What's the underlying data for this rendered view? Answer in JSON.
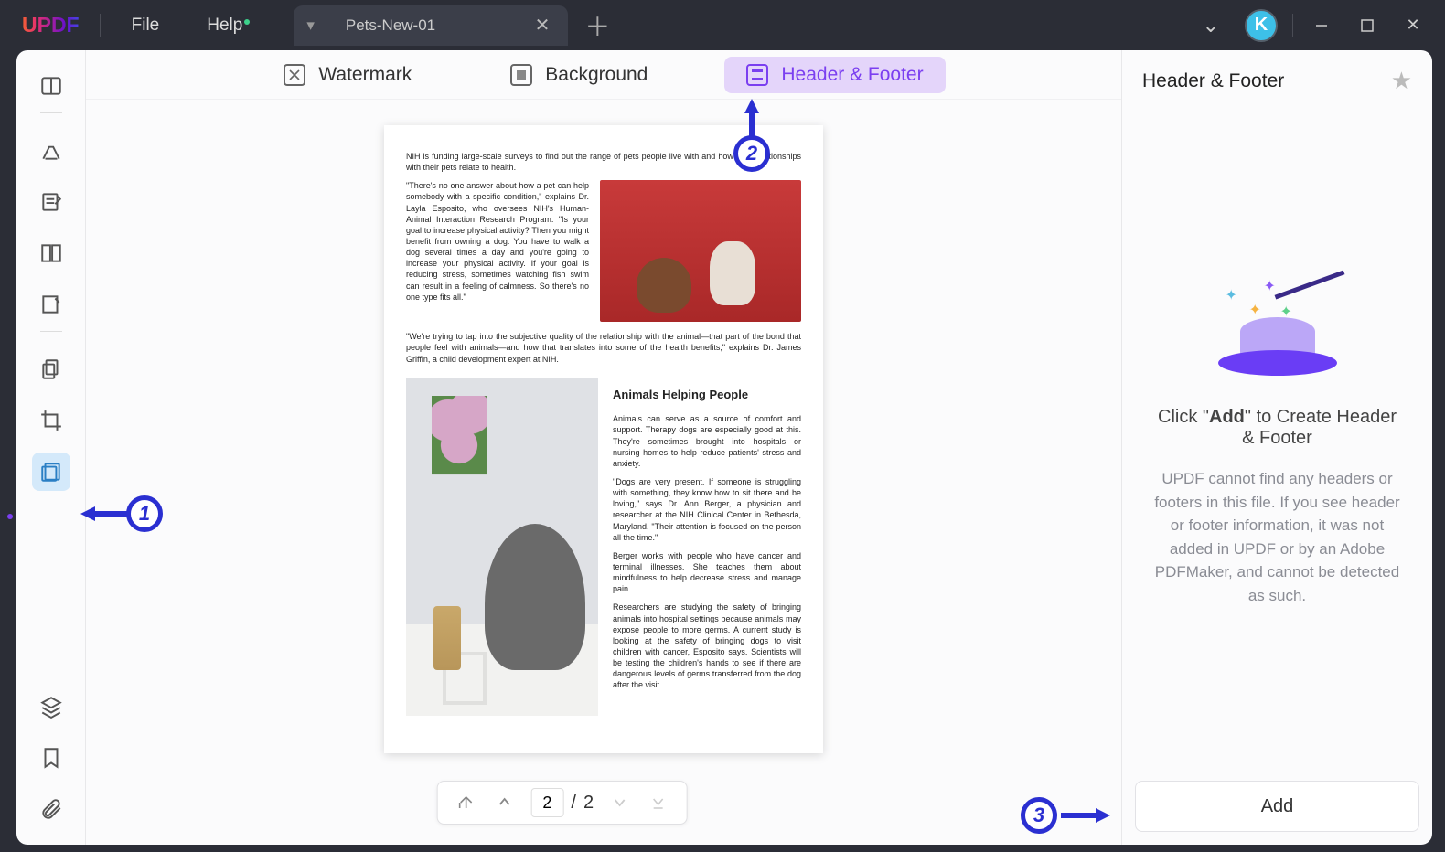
{
  "titlebar": {
    "logo": "UPDF",
    "menu": {
      "file": "File",
      "help": "Help"
    },
    "tab": {
      "name": "Pets-New-01"
    },
    "avatar_initial": "K"
  },
  "tool_tabs": {
    "watermark": "Watermark",
    "background": "Background",
    "header_footer": "Header & Footer"
  },
  "document": {
    "intro": "NIH is funding large-scale surveys to find out the range of pets people live with and how their relationships with their pets relate to health.",
    "p1": "\"There's no one answer about how a pet can help somebody with a specific condition,\" explains Dr. Layla Esposito, who oversees NIH's Human-Animal Interaction Research Program. \"Is your goal to increase physical activity? Then you might benefit from owning a dog. You have to walk a dog several times a day and you're going to increase your physical activity. If your goal is reducing stress, sometimes watching fish swim can result in a feeling of calmness. So there's no one type fits all.\"",
    "p2": "\"We're trying to tap into the subjective quality of the relationship with the animal—that part of the bond that people feel with animals—and how that translates into some of the health benefits,\" explains Dr. James Griffin, a child development expert at NIH.",
    "heading2": "Animals Helping People",
    "p3": "Animals can serve as a source of comfort and support. Therapy dogs are especially good at this. They're sometimes brought into hospitals or nursing homes to help reduce patients' stress and anxiety.",
    "p4": "\"Dogs are very present. If someone is struggling with something, they know how to sit there and be loving,\" says Dr. Ann Berger, a physician and researcher at the NIH Clinical Center in Bethesda, Maryland. \"Their attention is focused on the person all the time.\"",
    "p5": "Berger works with people who have cancer and terminal illnesses. She teaches them about mindfulness to help decrease stress and manage pain.",
    "p6": "Researchers are studying the safety of bringing animals into hospital settings because animals may expose people to more germs. A current study is looking at the safety of bringing dogs to visit children with cancer, Esposito says. Scientists will be testing the children's hands to see if there are dangerous levels of germs transferred from the dog after the visit."
  },
  "pagenav": {
    "current": "2",
    "sep": "/",
    "total": "2"
  },
  "rightpanel": {
    "title": "Header & Footer",
    "msg_pre": "Click \"",
    "msg_bold": "Add",
    "msg_post": "\" to Create Header & Footer",
    "desc": "UPDF cannot find any headers or footers in this file. If you see header or footer information, it was not added in UPDF or by an Adobe PDFMaker, and cannot be detected as such.",
    "add_btn": "Add"
  },
  "annotations": {
    "a1": "1",
    "a2": "2",
    "a3": "3"
  }
}
